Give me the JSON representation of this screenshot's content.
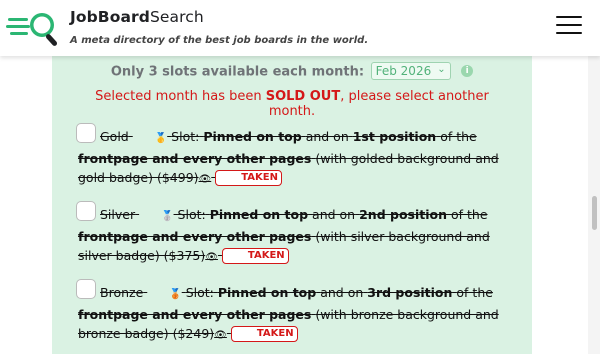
{
  "header": {
    "brand_bold": "JobBoard",
    "brand_light": "Search",
    "tagline": "A meta directory of the best job boards in the world.",
    "logo_icon": "magnifier-lines-icon",
    "menu_icon": "hamburger-menu-icon"
  },
  "panel": {
    "slots_text": "Only 3 slots available each month:",
    "month_selected": "Feb 2026",
    "soldout_prefix": "Selected month has been ",
    "soldout_bold": "SOLD OUT",
    "soldout_suffix": ", please select another month.",
    "taken_label": "TAKEN",
    "options": [
      {
        "tier": "Gold",
        "slot_label": "Slot:",
        "pinned": "Pinned on top",
        "and_on": "and on",
        "position": "1st position",
        "of_the": "of the",
        "pages": "frontpage and every other pages",
        "detail": "(with golded background and gold badge) ($499)"
      },
      {
        "tier": "Silver",
        "slot_label": "Slot:",
        "pinned": "Pinned on top",
        "and_on": "and on",
        "position": "2nd position",
        "of_the": "of the",
        "pages": "frontpage and every other pages",
        "detail": "(with silver background and silver badge) ($375)"
      },
      {
        "tier": "Bronze",
        "slot_label": "Slot:",
        "pinned": "Pinned on top",
        "and_on": "and on",
        "position": "3rd position",
        "of_the": "of the",
        "pages": "frontpage and every other pages",
        "detail": "(with bronze background and bronze badge) ($249)"
      }
    ]
  },
  "colors": {
    "panel_bg": "#daf2e3",
    "accent_green": "#2bb673",
    "sold_out_red": "#d41818"
  }
}
